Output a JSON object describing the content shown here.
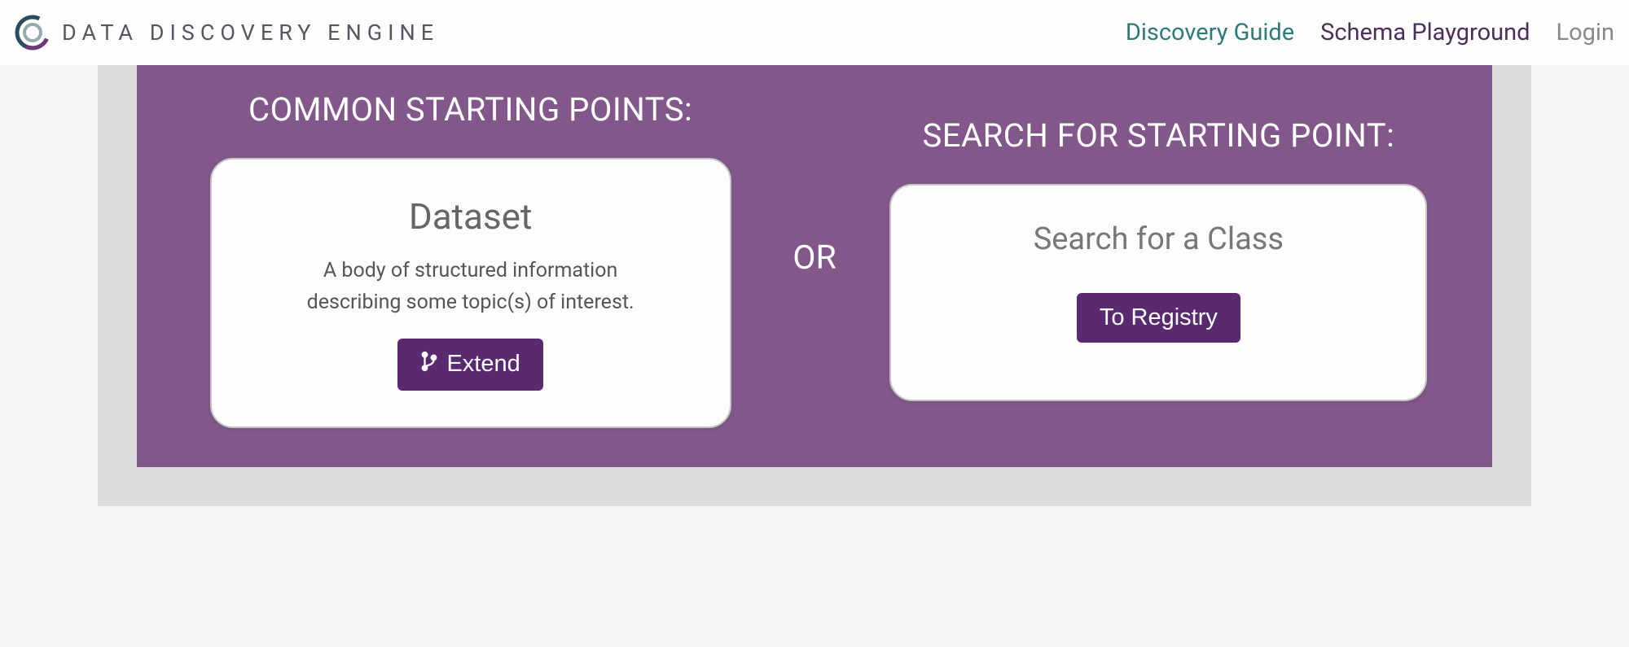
{
  "navbar": {
    "brand": "DATA  DISCOVERY  ENGINE",
    "links": {
      "discovery": "Discovery Guide",
      "playground": "Schema Playground",
      "login": "Login"
    }
  },
  "left": {
    "heading": "COMMON STARTING POINTS:",
    "card": {
      "title": "Dataset",
      "description": "A body of structured information describing some topic(s) of interest.",
      "button": "Extend"
    }
  },
  "divider": "OR",
  "right": {
    "heading": "SEARCH FOR STARTING POINT:",
    "card": {
      "title": "Search for a Class",
      "button": "To Registry"
    }
  }
}
